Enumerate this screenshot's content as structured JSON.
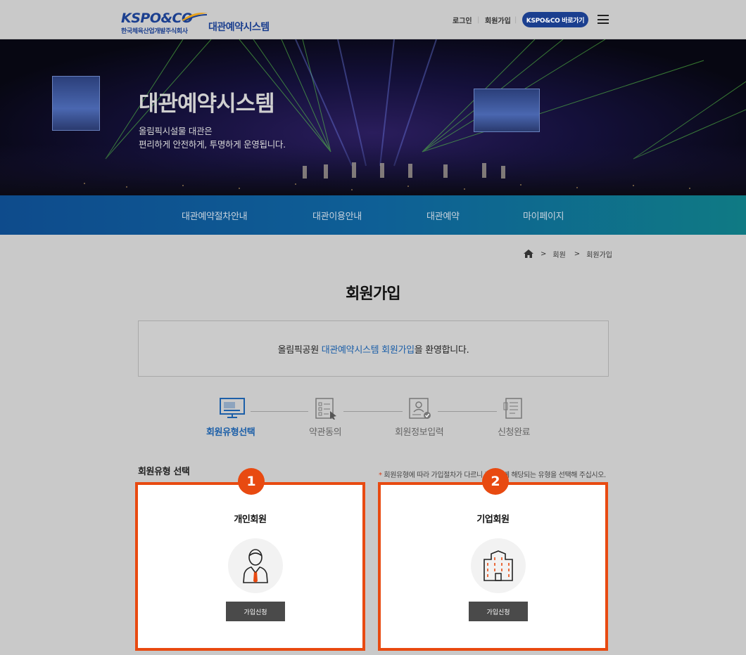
{
  "header": {
    "logo_text": "KSPO&CO",
    "logo_subtitle": "한국체육산업개발주식회사",
    "system_name": "대관예약시스템",
    "util_login": "로그인",
    "util_join": "회원가입",
    "kspo_button": "KSPO&CO 바로가기",
    "separator": "|"
  },
  "hero": {
    "title": "대관예약시스템",
    "desc_line1": "올림픽시설물 대관은",
    "desc_line2": "편리하게 안전하게, 투명하게 운영됩니다."
  },
  "gnb": [
    "대관예약절차안내",
    "대관이용안내",
    "대관예약",
    "마이페이지"
  ],
  "breadcrumb": {
    "level1": "회원",
    "level2": "회원가입",
    "separator": ">"
  },
  "page_title": "회원가입",
  "welcome": {
    "prefix": "올림픽공원 ",
    "highlight": "대관예약시스템 회원가입",
    "suffix": "을 환영합니다."
  },
  "steps": [
    {
      "label": "회원유형선택",
      "icon": "monitor-icon",
      "active": true
    },
    {
      "label": "약관동의",
      "icon": "checklist-icon",
      "active": false
    },
    {
      "label": "회원정보입력",
      "icon": "profile-card-icon",
      "active": false
    },
    {
      "label": "신청완료",
      "icon": "document-icon",
      "active": false
    }
  ],
  "section": {
    "title": "회원유형 선택",
    "notice_star": "*",
    "notice": " 회원유형에 따라 가입절차가 다르니 회원님께 해당되는 유형을 선택해 주십시오."
  },
  "cards": [
    {
      "badge": "1",
      "title": "개인회원",
      "icon": "person-icon",
      "button": "가입신청"
    },
    {
      "badge": "2",
      "title": "기업회원",
      "icon": "building-icon",
      "button": "가입신청"
    }
  ],
  "colors": {
    "brand_blue": "#1b3f8f",
    "accent_orange": "#e84a11",
    "active_step": "#1c5fa8"
  }
}
